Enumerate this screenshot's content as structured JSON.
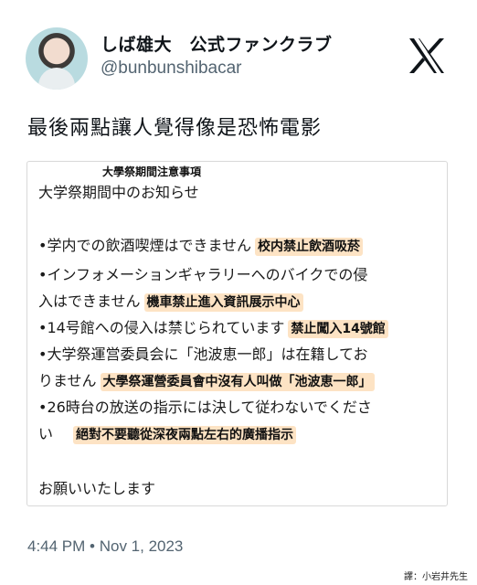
{
  "profile": {
    "display_name": "しば雄大　公式ファンクラブ",
    "handle": "@bunbunshibacar"
  },
  "icons": {
    "avatar": "profile-photo",
    "logo": "x-logo-icon"
  },
  "tweet": {
    "text": "最後兩點讓人覺得像是恐怖電影",
    "timestamp": "4:44 PM • Nov 1, 2023"
  },
  "notice": {
    "annotation_title": "大學祭期間注意事項",
    "title": "大学祭期間中のお知らせ",
    "items": [
      {
        "text": "•学内での飲酒喫煙はできません",
        "annotation": "校内禁止飲酒吸菸"
      },
      {
        "text": "•インフォメーションギャラリーへのバイクでの侵",
        "annotation": ""
      },
      {
        "text": "入はできません",
        "annotation": "機車禁止進入資訊展示中心"
      },
      {
        "text": "•14号館への侵入は禁じられています",
        "annotation": "禁止闖入14號館"
      },
      {
        "text": "•大学祭運営委員会に「池波恵一郎」は在籍してお",
        "annotation": ""
      },
      {
        "text": "りません",
        "annotation": "大學祭運營委員會中沒有人叫做「池波恵一郎」"
      },
      {
        "text": "•26時台の放送の指示には決して従わないでくださ",
        "annotation": ""
      },
      {
        "text": "い",
        "annotation": "絕對不要聽從深夜兩點左右的廣播指示"
      }
    ],
    "closing": "お願いいたします"
  },
  "credit": "譯：小岩井先生"
}
